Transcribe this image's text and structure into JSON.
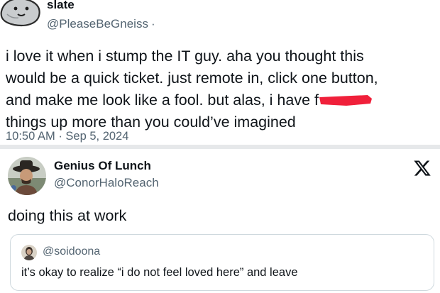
{
  "tweet1": {
    "name": "slate",
    "handle": "@PleaseBeGneiss",
    "handle_separator": "·",
    "lines": [
      "i love it when i stump the IT guy. aha you thought this",
      "would be a quick ticket. just remote in, click one button,",
      "and make me look like a fool. but alas, i have f",
      "things up more than you could’ve imagined"
    ],
    "redaction_color": "#f0203a",
    "time": "10:50 AM",
    "separator": "·",
    "date": "Sep 5, 2024"
  },
  "tweet2": {
    "name": "Genius Of Lunch",
    "handle": "@ConorHaloReach",
    "body": "doing this at work",
    "logo_icon": "x-logo-icon",
    "quoted": {
      "handle": "@soidoona",
      "body": "it’s okay to realize “i do not feel loved here” and leave"
    }
  },
  "colors": {
    "text": "#0f1419",
    "secondary": "#536471",
    "divider": "#e6e8ea",
    "quote_border": "#cfd9de"
  }
}
